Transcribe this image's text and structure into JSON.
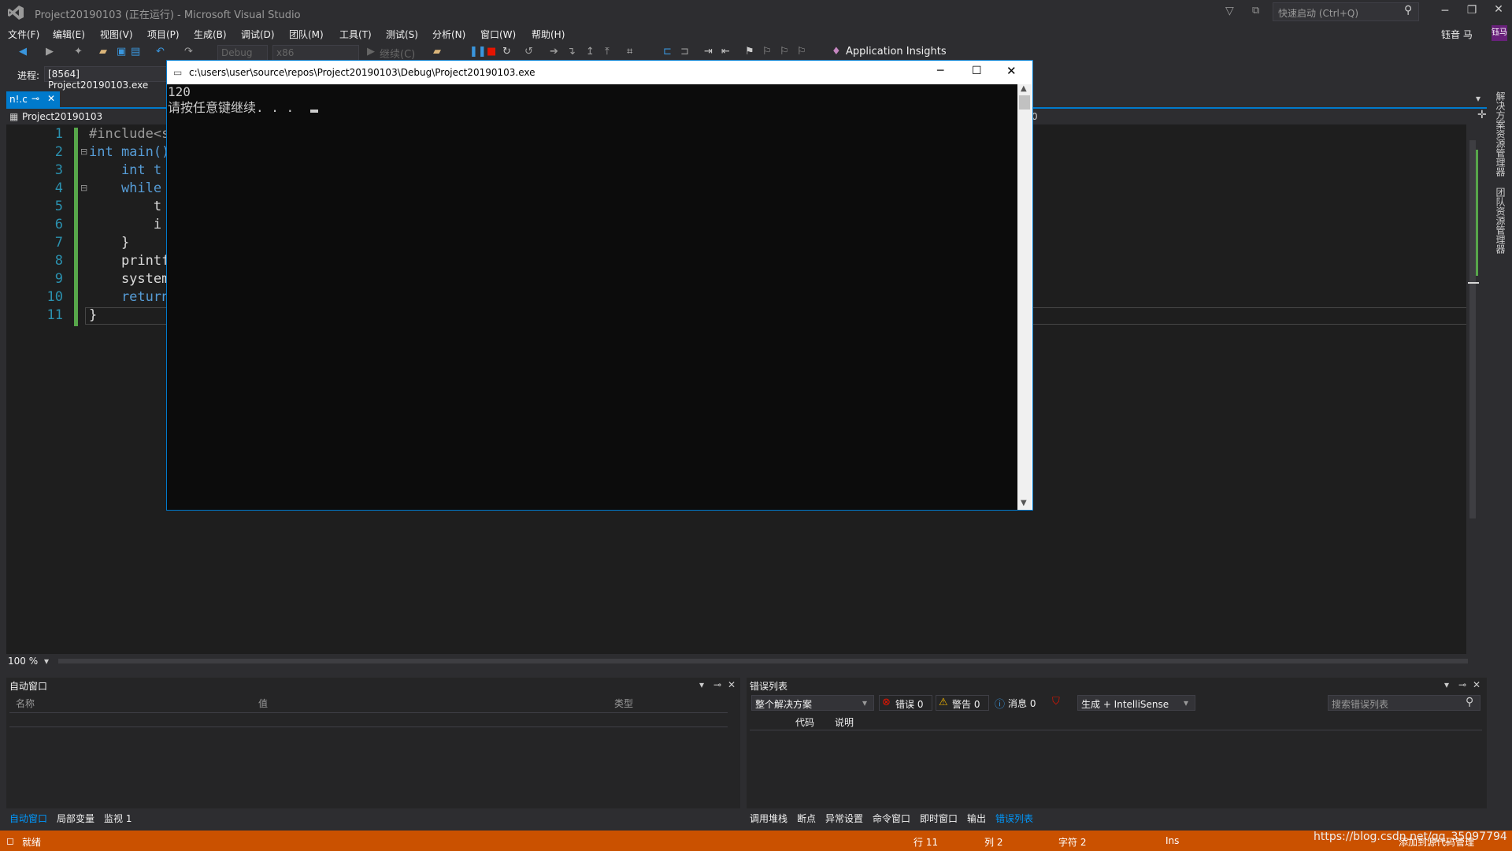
{
  "title_bar": {
    "title": "Project20190103 (正在运行) - Microsoft Visual Studio",
    "quick_launch_placeholder": "快速启动 (Ctrl+Q)",
    "user_name": "钰音 马",
    "user_initials": "钰马"
  },
  "menu": [
    "文件(F)",
    "编辑(E)",
    "视图(V)",
    "项目(P)",
    "生成(B)",
    "调试(D)",
    "团队(M)",
    "工具(T)",
    "测试(S)",
    "分析(N)",
    "窗口(W)",
    "帮助(H)"
  ],
  "toolbar": {
    "config": "Debug",
    "platform": "x86",
    "continue_label": "继续(C)",
    "app_insights": "Application Insights"
  },
  "process_bar": {
    "label": "进程:",
    "value": "[8564] Project20190103.exe"
  },
  "editor": {
    "tab_label": "n!.c",
    "project_nav": "Project20190103",
    "nav_right_text": "0",
    "zoom": "100 %",
    "lines": [
      {
        "n": "1",
        "t": "#include<s"
      },
      {
        "n": "2",
        "t": "int main()"
      },
      {
        "n": "3",
        "t": "    int t"
      },
      {
        "n": "4",
        "t": "    while"
      },
      {
        "n": "5",
        "t": "        t"
      },
      {
        "n": "6",
        "t": "        i"
      },
      {
        "n": "7",
        "t": "    }"
      },
      {
        "n": "8",
        "t": "    printf"
      },
      {
        "n": "9",
        "t": "    system"
      },
      {
        "n": "10",
        "t": "    return"
      },
      {
        "n": "11",
        "t": "}"
      }
    ]
  },
  "console": {
    "path": "c:\\users\\user\\source\\repos\\Project20190103\\Debug\\Project20190103.exe",
    "output_line1": "120",
    "output_line2": "请按任意键继续. . . "
  },
  "autos_panel": {
    "title": "自动窗口",
    "col_name": "名称",
    "col_value": "值",
    "col_type": "类型",
    "tabs": [
      "自动窗口",
      "局部变量",
      "监视 1"
    ]
  },
  "error_panel": {
    "title": "错误列表",
    "scope": "整个解决方案",
    "errors": "错误 0",
    "warnings": "警告 0",
    "messages": "消息 0",
    "build_filter": "生成 + IntelliSense",
    "search_placeholder": "搜索错误列表",
    "col_code": "代码",
    "col_desc": "说明",
    "tabs": [
      "调用堆栈",
      "断点",
      "异常设置",
      "命令窗口",
      "即时窗口",
      "输出",
      "错误列表"
    ]
  },
  "side_tabs": [
    "解决方案资源管理器",
    "团队资源管理器"
  ],
  "status_bar": {
    "ready": "就绪",
    "row": "行 11",
    "col": "列 2",
    "char": "字符 2",
    "ins": "Ins",
    "source_control": "添加到源代码管理",
    "watermark": "https://blog.csdn.net/qq_35097794"
  },
  "colors": {
    "accent": "#007acc",
    "status": "#ca5100"
  }
}
